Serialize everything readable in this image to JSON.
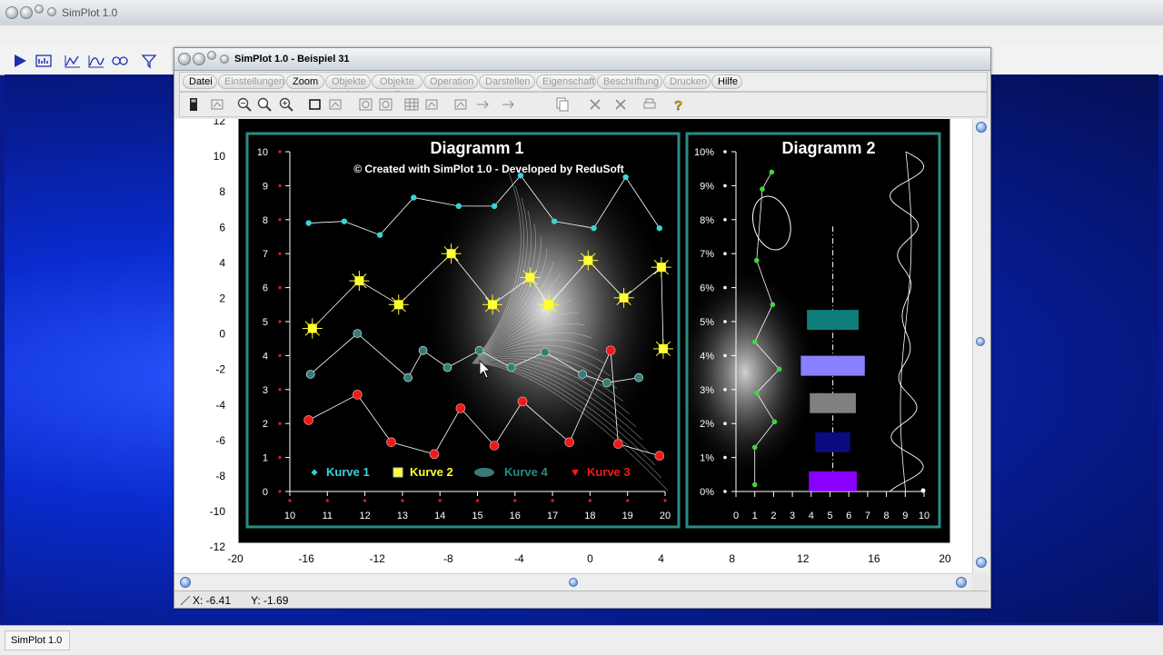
{
  "app": {
    "title": "SimPlot 1.0",
    "taskbar_label": "SimPlot 1.0",
    "toolbar_icons": [
      "play-icon",
      "graph-icon",
      "line-chart-icon",
      "xy-chart-icon",
      "polar-chart-icon",
      "funnel-icon"
    ]
  },
  "window": {
    "title": "SimPlot 1.0 - Beispiel 31",
    "menu": [
      {
        "label": "Datei",
        "active": true
      },
      {
        "label": "Einstellungen",
        "active": false
      },
      {
        "label": "Zoom",
        "active": true
      },
      {
        "label": "Objekte I",
        "active": false
      },
      {
        "label": "Objekte II",
        "active": false
      },
      {
        "label": "Operation",
        "active": false
      },
      {
        "label": "Darstellen",
        "active": false
      },
      {
        "label": "Eigenschaft",
        "active": false
      },
      {
        "label": "Beschriftung",
        "active": false
      },
      {
        "label": "Drucken",
        "active": false
      },
      {
        "label": "Hilfe",
        "active": true
      }
    ],
    "toolbar_icons": [
      "window-icon",
      "curve-icon",
      "zoom-out-icon",
      "zoom-icon",
      "zoom-in-icon",
      "rectangle-icon",
      "select-icon",
      "circle-icon",
      "circle2-icon",
      "table-icon",
      "image-icon",
      "align-icon",
      "arrow-right-icon",
      "arrow-left-icon",
      "copy-icon",
      "delete-icon",
      "delete-all-icon",
      "print-icon",
      "help-icon"
    ]
  },
  "status": {
    "x": "X: -6.41",
    "y": "Y: -1.69"
  },
  "colors": {
    "teal": "#2a8c86",
    "cyan": "#39d4d8",
    "yellow": "#ffff33",
    "green": "#3ed63e",
    "red": "#ee1b1b",
    "darkteal": "#3a7a76"
  },
  "chart_data": [
    {
      "type": "axes",
      "description_none": "",
      "left_ticks": [
        "12",
        "10",
        "8",
        "6",
        "4",
        "2",
        "0",
        "-2",
        "-4",
        "-6",
        "-8",
        "-10",
        "-12"
      ],
      "bottom_ticks": [
        "-20",
        "-16",
        "-12",
        "-8",
        "-4",
        "0",
        "4",
        "8",
        "12",
        "16",
        "20"
      ],
      "xlim": [
        -20,
        20
      ],
      "ylim": [
        -12,
        12
      ]
    },
    {
      "type": "scatter",
      "title": "Diagramm 1",
      "subtitle": "© Created with SimPlot 1.0 - Developed by ReduSoft",
      "x_ticks": [
        "10",
        "11",
        "12",
        "13",
        "14",
        "15",
        "16",
        "17",
        "18",
        "19",
        "20"
      ],
      "y_ticks": [
        "10",
        "9",
        "8",
        "7",
        "6",
        "5",
        "4",
        "3",
        "2",
        "1",
        "0"
      ],
      "xlim": [
        10,
        20
      ],
      "ylim": [
        0,
        10
      ],
      "legend": [
        {
          "label": "Kurve 1",
          "color": "#39d4d8"
        },
        {
          "label": "Kurve 2",
          "color": "#ffff33"
        },
        {
          "label": "Kurve 4",
          "color": "#2a8c86"
        },
        {
          "label": "Kurve 3",
          "color": "#ee1b1b"
        }
      ],
      "series": [
        {
          "name": "Kurve 1",
          "x": [
            10.5,
            11.45,
            12.4,
            13.3,
            14.5,
            15.45,
            16.15,
            17.05,
            18.1,
            18.95,
            19.85
          ],
          "y": [
            7.9,
            7.95,
            7.55,
            8.65,
            8.4,
            8.4,
            9.3,
            7.95,
            7.75,
            9.25,
            7.75
          ]
        },
        {
          "name": "Kurve 2",
          "x": [
            10.6,
            11.85,
            12.9,
            14.3,
            15.4,
            16.4,
            16.9,
            17.95,
            18.9,
            19.9,
            19.95
          ],
          "y": [
            4.8,
            6.2,
            5.5,
            7.0,
            5.5,
            6.3,
            5.5,
            6.8,
            5.7,
            6.6,
            4.2
          ]
        },
        {
          "name": "Kurve 4",
          "x": [
            10.55,
            11.8,
            13.15,
            13.55,
            14.2,
            15.05,
            15.9,
            16.8,
            17.8,
            18.45,
            19.3
          ],
          "y": [
            3.45,
            4.65,
            3.35,
            4.15,
            3.65,
            4.15,
            3.65,
            4.1,
            3.45,
            3.2,
            3.35
          ]
        },
        {
          "name": "Kurve 3",
          "x": [
            10.5,
            11.8,
            12.7,
            13.85,
            14.55,
            15.45,
            16.2,
            17.45,
            18.55,
            18.75,
            19.85
          ],
          "y": [
            2.1,
            2.85,
            1.45,
            1.1,
            2.45,
            1.35,
            2.65,
            1.45,
            4.15,
            1.4,
            1.05
          ]
        }
      ]
    },
    {
      "type": "mixed",
      "title": "Diagramm 2",
      "x_ticks": [
        "0",
        "1",
        "2",
        "3",
        "4",
        "5",
        "6",
        "7",
        "8",
        "9",
        "10"
      ],
      "y_ticks": [
        "10%",
        "9%",
        "8%",
        "7%",
        "6%",
        "5%",
        "4%",
        "3%",
        "2%",
        "1%",
        "0%"
      ],
      "xlim": [
        0,
        10
      ],
      "ylim": [
        0,
        10
      ],
      "green_points": {
        "x": [
          1.9,
          1.4,
          1.1,
          1.95,
          1.0,
          2.3,
          1.1,
          2.05,
          1.0,
          1.0
        ],
        "y": [
          9.4,
          8.9,
          6.8,
          5.5,
          4.4,
          3.6,
          2.9,
          2.05,
          1.3,
          0.2
        ]
      },
      "bars": [
        {
          "center": 5.15,
          "value": 5.05,
          "width": 2.75,
          "color": "#0f7d7a"
        },
        {
          "center": 5.15,
          "value": 3.7,
          "width": 3.4,
          "color": "#8a80ff"
        },
        {
          "center": 5.15,
          "value": 2.6,
          "width": 2.45,
          "color": "#808080"
        },
        {
          "center": 5.15,
          "value": 1.45,
          "width": 1.85,
          "color": "#0b0b80"
        },
        {
          "center": 5.15,
          "value": 0.3,
          "width": 2.55,
          "color": "#8a00ff"
        }
      ]
    }
  ]
}
